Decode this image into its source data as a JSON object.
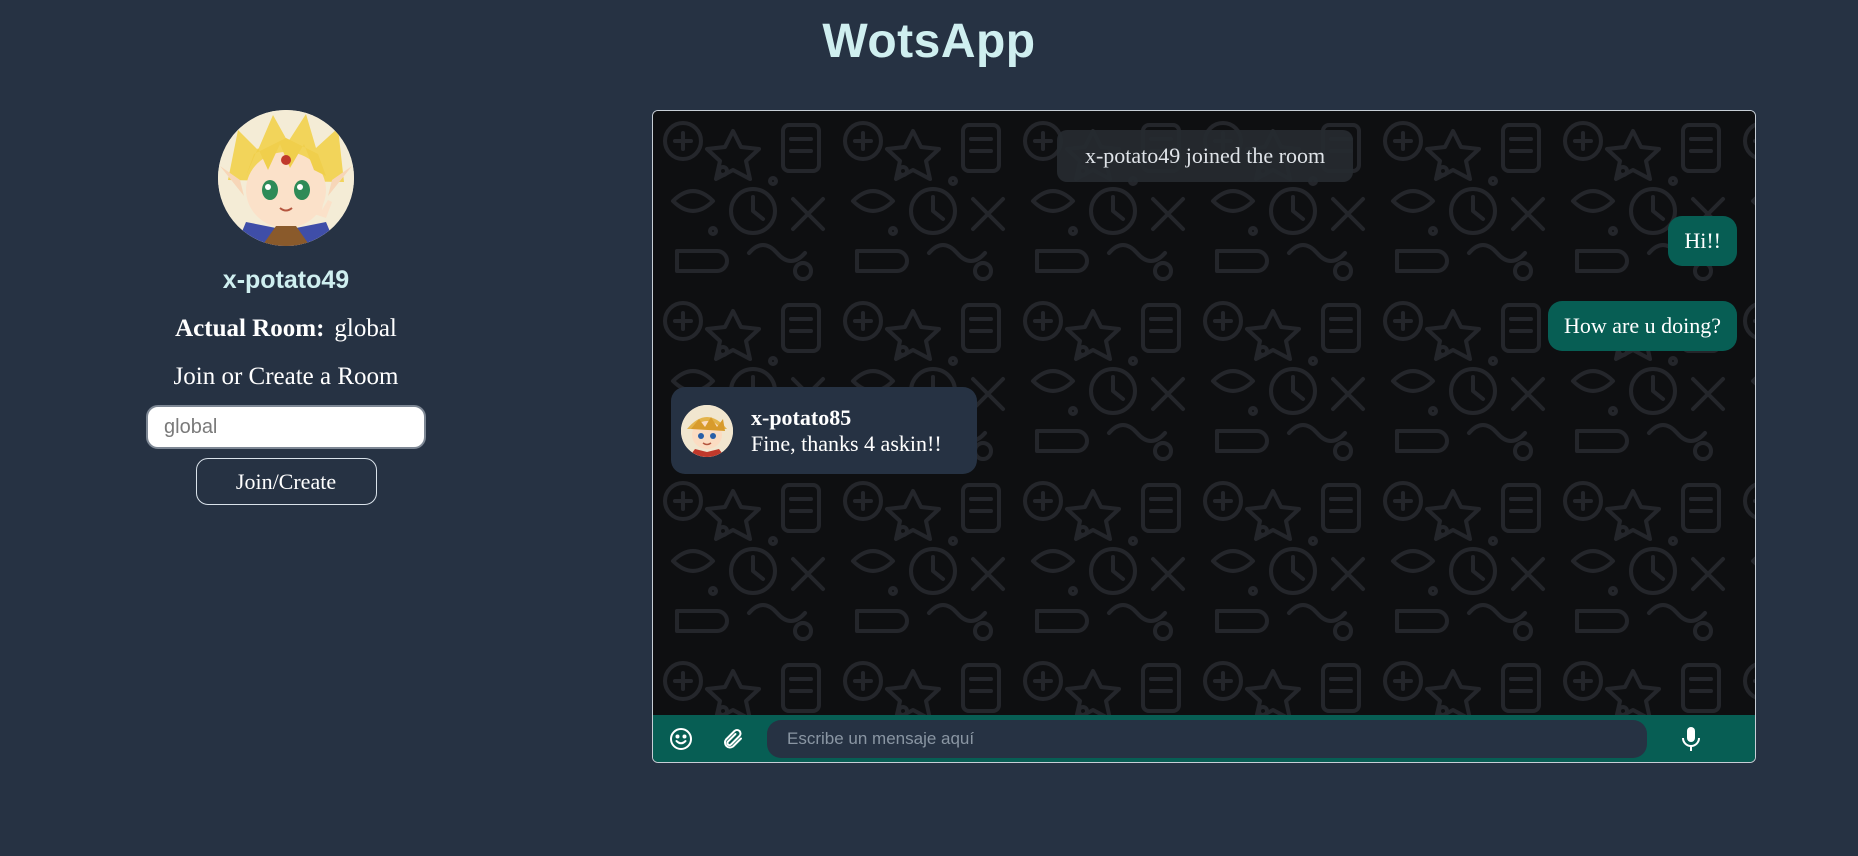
{
  "app": {
    "title": "WotsApp"
  },
  "profile": {
    "username": "x-potato49",
    "room_label": "Actual Room:",
    "room_value": "global",
    "join_prompt": "Join or Create a Room",
    "room_input_placeholder": "global",
    "join_button": "Join/Create"
  },
  "chat": {
    "system_message": "x-potato49 joined the room",
    "outgoing": [
      {
        "text": "Hi!!"
      },
      {
        "text": "How are u doing?"
      }
    ],
    "incoming": [
      {
        "sender": "x-potato85",
        "text": "Fine, thanks 4 askin!!"
      }
    ]
  },
  "composer": {
    "placeholder": "Escribe un mensaje aquí",
    "emoji_icon": "emoji-icon",
    "attach_icon": "paperclip-icon",
    "mic_icon": "microphone-icon"
  },
  "colors": {
    "page_bg": "#263243",
    "title": "#cfeff0",
    "outgoing_bubble": "#075e54",
    "incoming_bubble": "#263243",
    "chat_bg": "#0e0f11"
  }
}
